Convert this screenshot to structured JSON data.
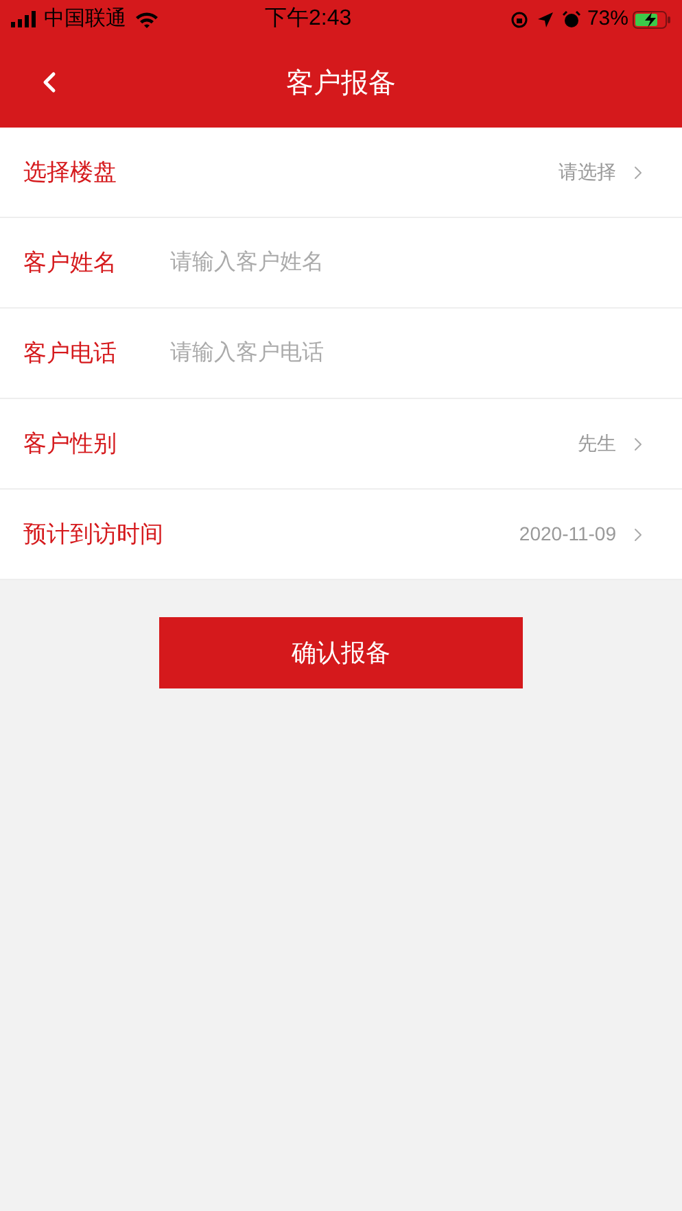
{
  "status_bar": {
    "carrier": "中国联通",
    "time": "下午2:43",
    "battery": "73%"
  },
  "nav": {
    "title": "客户报备"
  },
  "form": [
    {
      "kind": "select",
      "label": "选择楼盘",
      "value": "请选择"
    },
    {
      "kind": "input",
      "label": "客户姓名",
      "placeholder": "请输入客户姓名"
    },
    {
      "kind": "input",
      "label": "客户电话",
      "placeholder": "请输入客户电话"
    },
    {
      "kind": "select",
      "label": "客户性别",
      "value": "先生"
    },
    {
      "kind": "select",
      "label": "预计到访时间",
      "value": "2020-11-09"
    }
  ],
  "submit": {
    "label": "确认报备"
  }
}
